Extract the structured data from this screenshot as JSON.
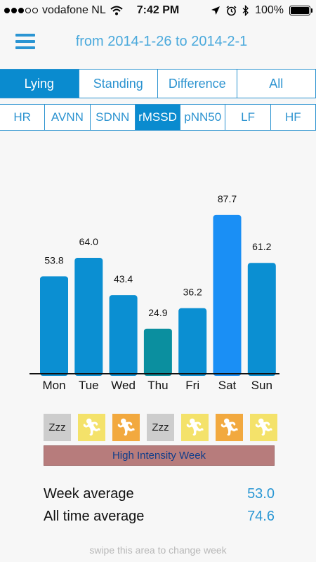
{
  "status_bar": {
    "carrier": "vodafone NL",
    "time": "7:42 PM",
    "battery": "100%",
    "signal_bars": 3,
    "signal_total": 5,
    "icons": [
      "wifi-icon",
      "location-icon",
      "alarm-icon",
      "bluetooth-icon",
      "battery-icon"
    ]
  },
  "header": {
    "date_range": "from 2014-1-26 to 2014-2-1"
  },
  "position_tabs": [
    {
      "label": "Lying",
      "active": true
    },
    {
      "label": "Standing",
      "active": false
    },
    {
      "label": "Difference",
      "active": false
    },
    {
      "label": "All",
      "active": false
    }
  ],
  "metric_tabs": [
    {
      "label": "HR",
      "active": false
    },
    {
      "label": "AVNN",
      "active": false
    },
    {
      "label": "SDNN",
      "active": false
    },
    {
      "label": "rMSSD",
      "active": true
    },
    {
      "label": "pNN50",
      "active": false
    },
    {
      "label": "LF",
      "active": false
    },
    {
      "label": "HF",
      "active": false
    }
  ],
  "chart_data": {
    "type": "bar",
    "categories": [
      "Mon",
      "Tue",
      "Wed",
      "Thu",
      "Fri",
      "Sat",
      "Sun"
    ],
    "values": [
      53.8,
      64.0,
      43.4,
      24.9,
      36.2,
      87.7,
      61.2
    ],
    "value_labels": [
      "53.8",
      "64.0",
      "43.4",
      "24.9",
      "36.2",
      "87.7",
      "61.2"
    ],
    "bar_colors": [
      "#0b8fd2",
      "#0b8fd2",
      "#0b8fd2",
      "#0b8f9f",
      "#0b8fd2",
      "#1a8ff5",
      "#0b8fd2"
    ],
    "ylim": [
      0,
      90
    ],
    "grid": false,
    "title": "",
    "xlabel": "",
    "ylabel": ""
  },
  "intensity_icons": [
    {
      "type": "rest",
      "label": "Zzz",
      "icon": "sleep-icon"
    },
    {
      "type": "light",
      "label": "",
      "icon": "runner-icon"
    },
    {
      "type": "hard",
      "label": "",
      "icon": "runner-icon"
    },
    {
      "type": "rest",
      "label": "Zzz",
      "icon": "sleep-icon"
    },
    {
      "type": "light",
      "label": "",
      "icon": "runner-icon"
    },
    {
      "type": "hard",
      "label": "",
      "icon": "runner-icon"
    },
    {
      "type": "light",
      "label": "",
      "icon": "runner-icon"
    }
  ],
  "week_label": "High Intensity Week",
  "averages": {
    "week_label": "Week average",
    "week_value": "53.0",
    "all_label": "All time average",
    "all_value": "74.6"
  },
  "hint": "swipe this area to change week",
  "colors": {
    "accent": "#2c93d0",
    "active_tab": "#0a8bcf",
    "banner": "#b77c7c",
    "rest": "#cdcdcd",
    "light": "#f4e26a",
    "hard": "#f2a93f"
  }
}
